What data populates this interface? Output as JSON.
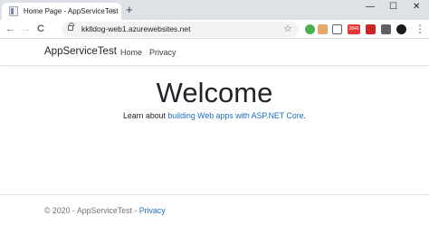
{
  "browser": {
    "tab_title": "Home Page - AppServiceTest",
    "tab_close": "×",
    "new_tab": "+",
    "minimize": "—",
    "maximize": "☐",
    "close": "✕",
    "back": "←",
    "forward": "→",
    "reload": "C",
    "url": "kklldog-web1.azurewebsites.net",
    "bookmark_star": "☆",
    "extension_badge": "2846",
    "menu": "⋮"
  },
  "site": {
    "brand": "AppServiceTest",
    "nav": [
      "Home",
      "Privacy"
    ],
    "heading": "Welcome",
    "lead_prefix": "Learn about ",
    "lead_link": "building Web apps with ASP.NET Core",
    "lead_suffix": ".",
    "footer_prefix": "© 2020 - AppServiceTest - ",
    "footer_link": "Privacy"
  },
  "colors": {
    "link": "#1b6ec2",
    "tabstrip": "#dee1e6",
    "text": "#212529"
  }
}
